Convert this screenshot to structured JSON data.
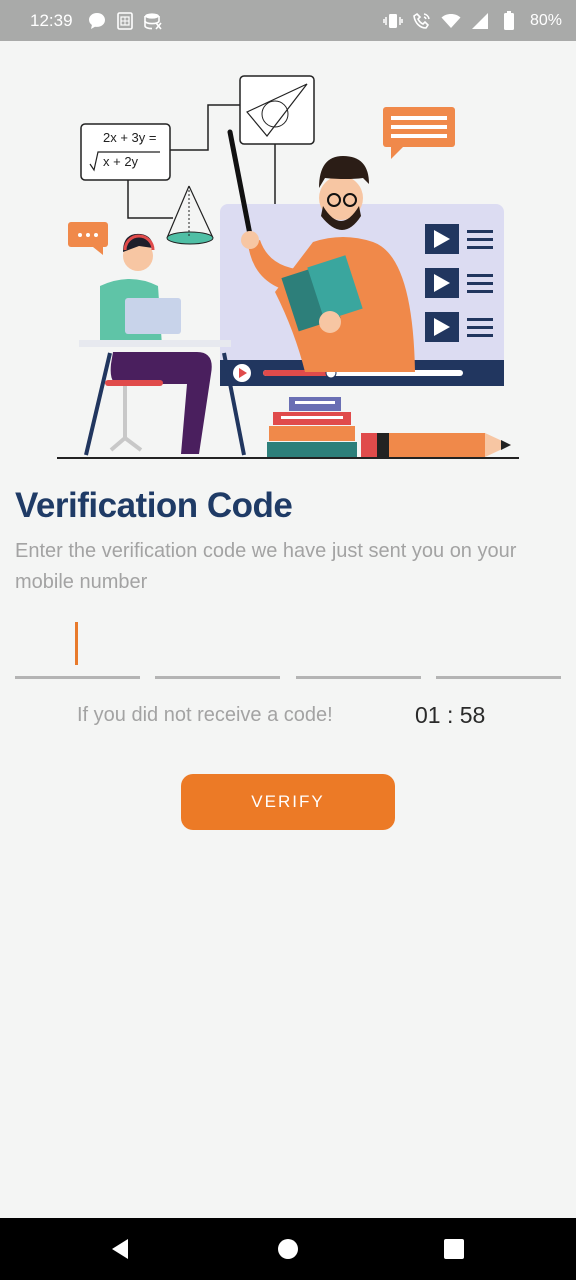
{
  "status_bar": {
    "time": "12:39",
    "left_icons": [
      "chat-bubble-icon",
      "sim-card-icon",
      "data-saver-icon"
    ],
    "right_icons": [
      "vibrate-icon",
      "wifi-calling-icon",
      "wifi-icon",
      "cell-signal-icon",
      "battery-icon"
    ],
    "battery": "80%"
  },
  "hero": {
    "equation_line1": "2x + 3y =",
    "equation_line2": "x + 2y",
    "illustration": "teacher-online-class-illustration"
  },
  "page": {
    "title": "Verification Code",
    "subtitle": "Enter the verification code we have just sent you on your mobile number"
  },
  "otp": {
    "digits": [
      "",
      "",
      "",
      ""
    ],
    "focused_index": 0
  },
  "resend": {
    "text": "If you did not receive a code!",
    "timer": "01 : 58"
  },
  "verify_button": {
    "label": "VERIFY"
  },
  "nav_bar": {
    "buttons": [
      "back-icon",
      "home-icon",
      "recents-icon"
    ]
  },
  "colors": {
    "primary": "#ec7a26",
    "title": "#1f3b66",
    "muted_text": "#a3a3a3",
    "background": "#f4f5f4"
  }
}
